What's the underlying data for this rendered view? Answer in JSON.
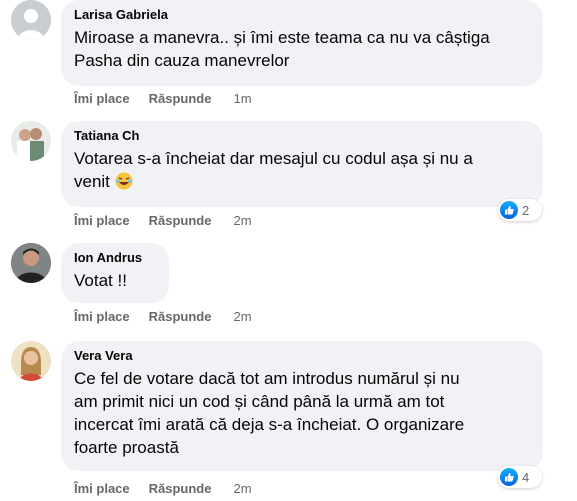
{
  "comments": [
    {
      "author": "Larisa Gabriela",
      "text": "Miroase a manevra.. și îmi este teama ca nu va câștiga Pasha din cauza manevrelor",
      "line1": "Miroase a manevra.. și îmi este teama ca nu va câștiga",
      "line2": "Pasha din cauza manevrelor",
      "like_label": "Îmi place",
      "reply_label": "Răspunde",
      "time": "1m"
    },
    {
      "author": "Tatiana Ch",
      "line1": "Votarea s-a încheiat dar mesajul cu codul așa și nu a",
      "line2": "venit",
      "emoji": "rolling-on-floor-laughing-emoji",
      "like_label": "Îmi place",
      "reply_label": "Răspunde",
      "time": "2m",
      "reaction_count": "2"
    },
    {
      "author": "Ion Andrus",
      "line1": "Votat !!",
      "like_label": "Îmi place",
      "reply_label": "Răspunde",
      "time": "2m"
    },
    {
      "author": "Vera Vera",
      "line1": "Ce fel de votare dacă tot am introdus numărul și nu",
      "line2": "am primit nici un cod și când până la urmă am tot",
      "line3": "incercat îmi arată că deja s-a încheiat. O organizare",
      "line4": "foarte proastă",
      "like_label": "Îmi place",
      "reply_label": "Răspunde",
      "time": "2m",
      "reaction_count": "4"
    }
  ],
  "colors": {
    "bubble": "#f0f2f5",
    "meta_text": "#65676b",
    "like_blue": "#0866ff"
  }
}
